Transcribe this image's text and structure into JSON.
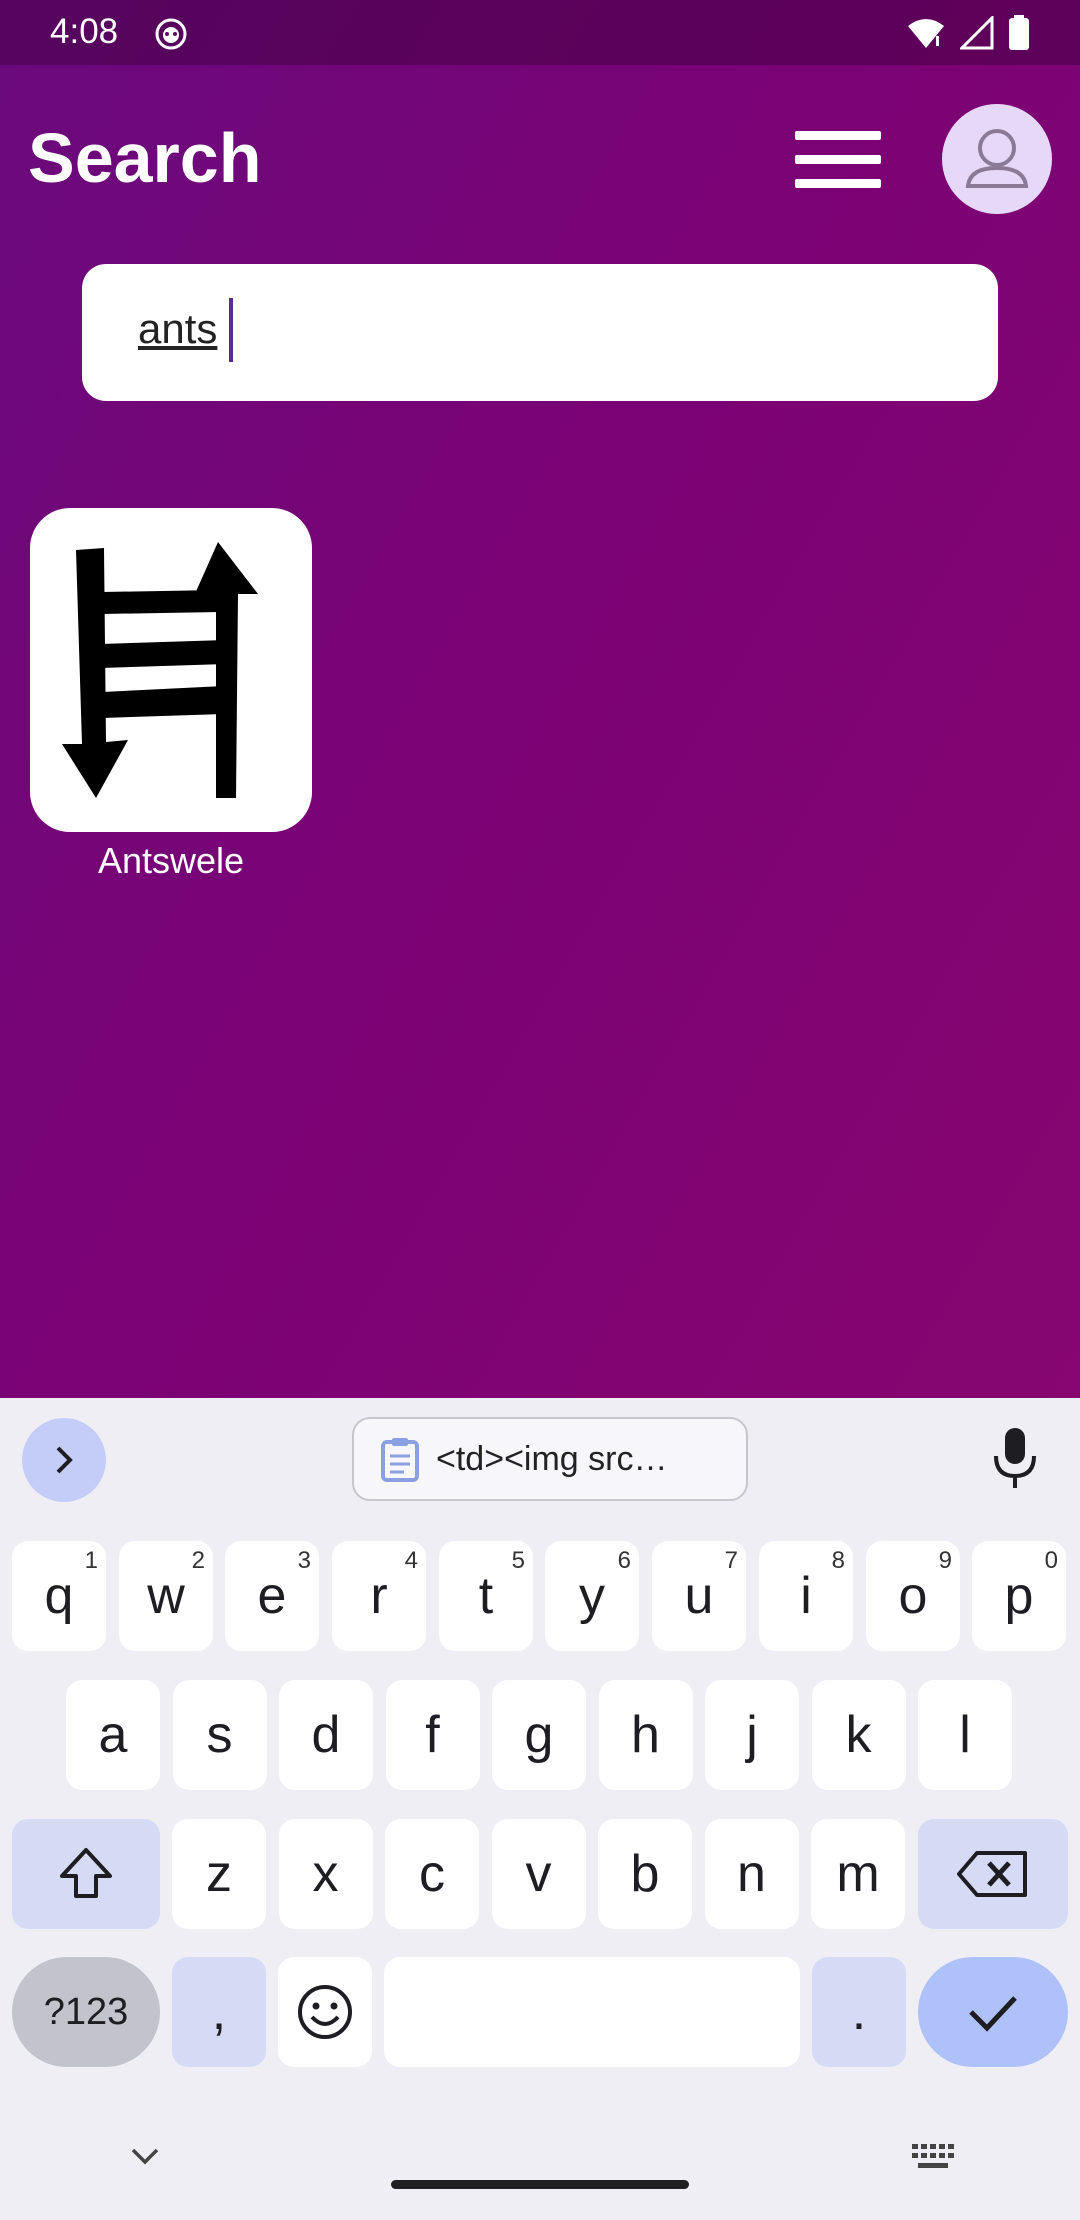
{
  "status_bar": {
    "time": "4:08",
    "icons": [
      "cat-notification-icon",
      "wifi-icon",
      "signal-icon",
      "battery-icon"
    ]
  },
  "header": {
    "title": "Search",
    "menu_icon": "hamburger-menu-icon",
    "avatar_icon": "user-avatar-icon"
  },
  "search": {
    "value": "ants",
    "placeholder": ""
  },
  "results": [
    {
      "label": "Antswele",
      "icon": "ladder-arrows-symbol"
    }
  ],
  "keyboard": {
    "clipboard_chip": "<td><img src…",
    "row1": [
      {
        "k": "q",
        "s": "1"
      },
      {
        "k": "w",
        "s": "2"
      },
      {
        "k": "e",
        "s": "3"
      },
      {
        "k": "r",
        "s": "4"
      },
      {
        "k": "t",
        "s": "5"
      },
      {
        "k": "y",
        "s": "6"
      },
      {
        "k": "u",
        "s": "7"
      },
      {
        "k": "i",
        "s": "8"
      },
      {
        "k": "o",
        "s": "9"
      },
      {
        "k": "p",
        "s": "0"
      }
    ],
    "row2": [
      "a",
      "s",
      "d",
      "f",
      "g",
      "h",
      "j",
      "k",
      "l"
    ],
    "row3": [
      "z",
      "x",
      "c",
      "v",
      "b",
      "n",
      "m"
    ],
    "symbols_key": "?123",
    "comma_key": ",",
    "period_key": ".",
    "colors": {
      "accent": "#aec2f9",
      "modifier": "#d5dbf5",
      "background": "#eeeef4"
    }
  },
  "colors": {
    "app_gradient_start": "#6a0a7c",
    "app_gradient_end": "#870670"
  }
}
